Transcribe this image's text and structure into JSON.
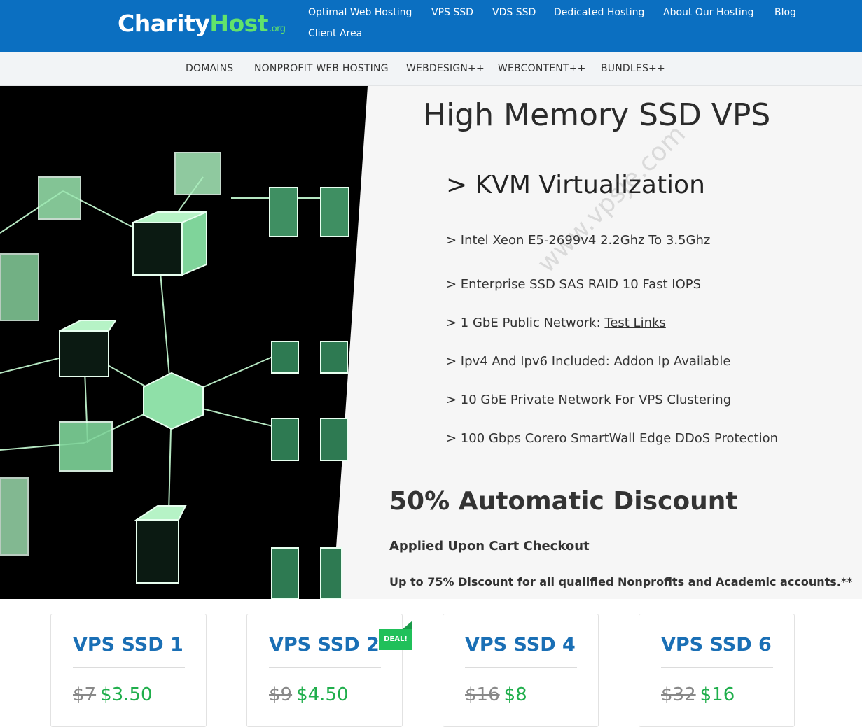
{
  "brand": {
    "part1": "Charity",
    "part2": "Host",
    "tld": ".org"
  },
  "top_nav": [
    "Optimal Web Hosting",
    "VPS SSD",
    "VDS SSD",
    "Dedicated Hosting",
    "About Our Hosting",
    "Blog",
    "Client Area"
  ],
  "sub_nav": [
    "DOMAINS",
    "NONPROFIT WEB HOSTING",
    "WEBDESIGN++",
    "WEBCONTENT++",
    "BUNDLES++"
  ],
  "hero": {
    "title": "High Memory SSD VPS",
    "subtitle": "> KVM Virtualization",
    "features": [
      "> Intel Xeon E5-2699v4 2.2Ghz To 3.5Ghz",
      "> Enterprise SSD SAS RAID 10 Fast IOPS",
      "> 1 GbE Public Network: ",
      "> Ipv4 And Ipv6 Included: Addon Ip Available",
      "> 10 GbE Private Network For VPS Clustering",
      "> 100 Gbps Corero SmartWall Edge DDoS Protection"
    ],
    "test_links": "Test Links",
    "discount_title": "50% Automatic Discount",
    "applied": "Applied Upon Cart Checkout",
    "upto": "Up to 75% Discount for all qualified Nonprofits and Academic accounts.**"
  },
  "watermark": "www.vpsje.com",
  "plans": [
    {
      "name": "VPS SSD 1",
      "old": "$7",
      "new": "$3.50"
    },
    {
      "name": "VPS SSD 2",
      "old": "$9",
      "new": "$4.50",
      "badge": "DEAL!"
    },
    {
      "name": "VPS SSD 4",
      "old": "$16",
      "new": "$8"
    },
    {
      "name": "VPS SSD 6",
      "old": "$32",
      "new": "$16"
    }
  ]
}
